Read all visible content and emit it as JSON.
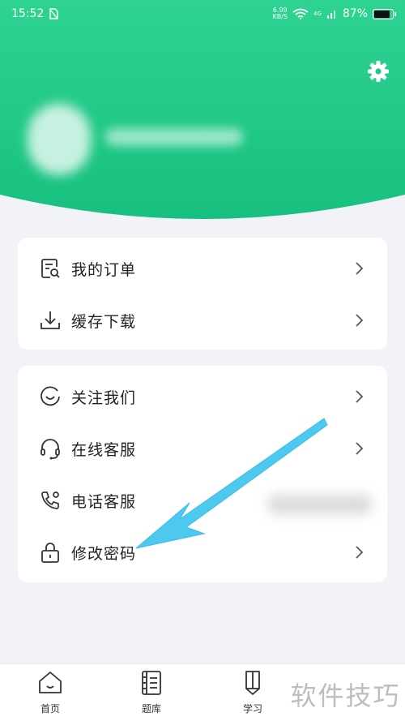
{
  "status_bar": {
    "time": "15:52",
    "speed_value": "6.99",
    "speed_unit": "KB/S",
    "network": "4G",
    "battery": "87%",
    "battery_level": 0.87
  },
  "colors": {
    "brand": "#21c788",
    "brand_dark": "#17b97b",
    "arrow": "#4dc8ee"
  },
  "menu_group_1": [
    {
      "label": "我的订单",
      "icon": "order-search-icon"
    },
    {
      "label": "缓存下载",
      "icon": "download-icon"
    }
  ],
  "menu_group_2": [
    {
      "label": "关注我们",
      "icon": "smile-icon"
    },
    {
      "label": "在线客服",
      "icon": "headset-icon"
    },
    {
      "label": "电话客服",
      "icon": "phone-icon"
    },
    {
      "label": "修改密码",
      "icon": "lock-icon"
    }
  ],
  "tab_bar": [
    {
      "label": "首页",
      "icon": "home-icon"
    },
    {
      "label": "题库",
      "icon": "question-bank-icon"
    },
    {
      "label": "学习",
      "icon": "pencil-icon"
    }
  ],
  "watermark": "软件技巧"
}
